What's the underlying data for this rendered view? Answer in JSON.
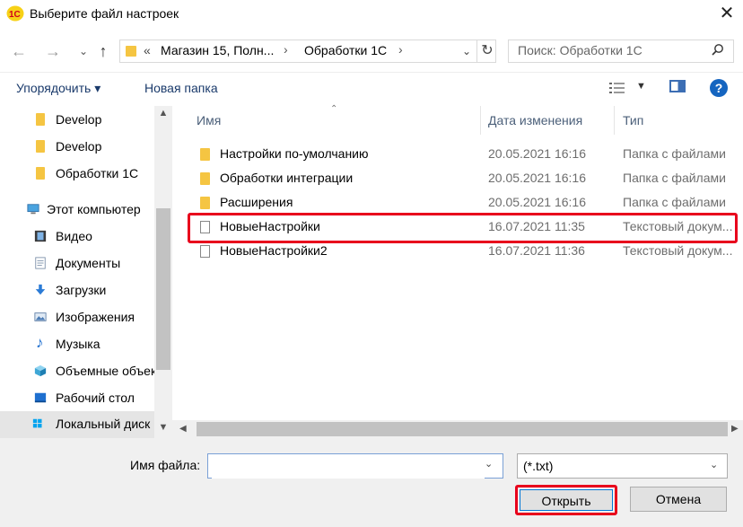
{
  "window": {
    "title": "Выберите файл настроек",
    "logo_text": "1С",
    "close_glyph": "✕"
  },
  "nav": {
    "back_glyph": "←",
    "forward_glyph": "→",
    "dropdown_glyph": "⌄",
    "up_glyph": "↑",
    "address_prefix": "«",
    "crumbs": [
      "Магазин 15, Полн...",
      "Обработки 1С"
    ],
    "crumb_sep": "›",
    "refresh_glyph": "↻",
    "search_placeholder": "Поиск: Обработки 1С"
  },
  "toolbar": {
    "organize_label": "Упорядочить ▾",
    "new_folder_label": "Новая папка",
    "help_glyph": "?"
  },
  "sidebar": {
    "items": [
      {
        "label": "Develop",
        "icon": "folder-icon"
      },
      {
        "label": "Develop",
        "icon": "folder-icon"
      },
      {
        "label": "Обработки 1С",
        "icon": "folder-icon"
      },
      {
        "label": "Этот компьютер",
        "icon": "computer-icon"
      },
      {
        "label": "Видео",
        "icon": "video-icon"
      },
      {
        "label": "Документы",
        "icon": "documents-icon"
      },
      {
        "label": "Загрузки",
        "icon": "downloads-icon"
      },
      {
        "label": "Изображения",
        "icon": "images-icon"
      },
      {
        "label": "Музыка",
        "icon": "music-icon"
      },
      {
        "label": "Объемные объекты",
        "icon": "3d-objects-icon"
      },
      {
        "label": "Рабочий стол",
        "icon": "desktop-icon"
      },
      {
        "label": "Локальный диск (C:)",
        "icon": "drive-icon"
      }
    ]
  },
  "files": {
    "columns": [
      "Имя",
      "Дата изменения",
      "Тип"
    ],
    "rows": [
      {
        "name": "Настройки по-умолчанию",
        "date": "20.05.2021 16:16",
        "type": "Папка с файлами",
        "kind": "folder"
      },
      {
        "name": "Обработки интеграции",
        "date": "20.05.2021 16:16",
        "type": "Папка с файлами",
        "kind": "folder"
      },
      {
        "name": "Расширения",
        "date": "20.05.2021 16:16",
        "type": "Папка с файлами",
        "kind": "folder"
      },
      {
        "name": "НовыеНастройки",
        "date": "16.07.2021 11:35",
        "type": "Текстовый докум...",
        "kind": "file"
      },
      {
        "name": "НовыеНастройки2",
        "date": "16.07.2021 11:36",
        "type": "Текстовый докум...",
        "kind": "file"
      }
    ]
  },
  "footer": {
    "filename_label": "Имя файла:",
    "filename_value": "",
    "filter_value": "(*.txt)",
    "open_label": "Открыть",
    "cancel_label": "Отмена"
  },
  "colors": {
    "highlight": "#e8001c",
    "folder": "#f5c542",
    "accent": "#0078d7"
  }
}
